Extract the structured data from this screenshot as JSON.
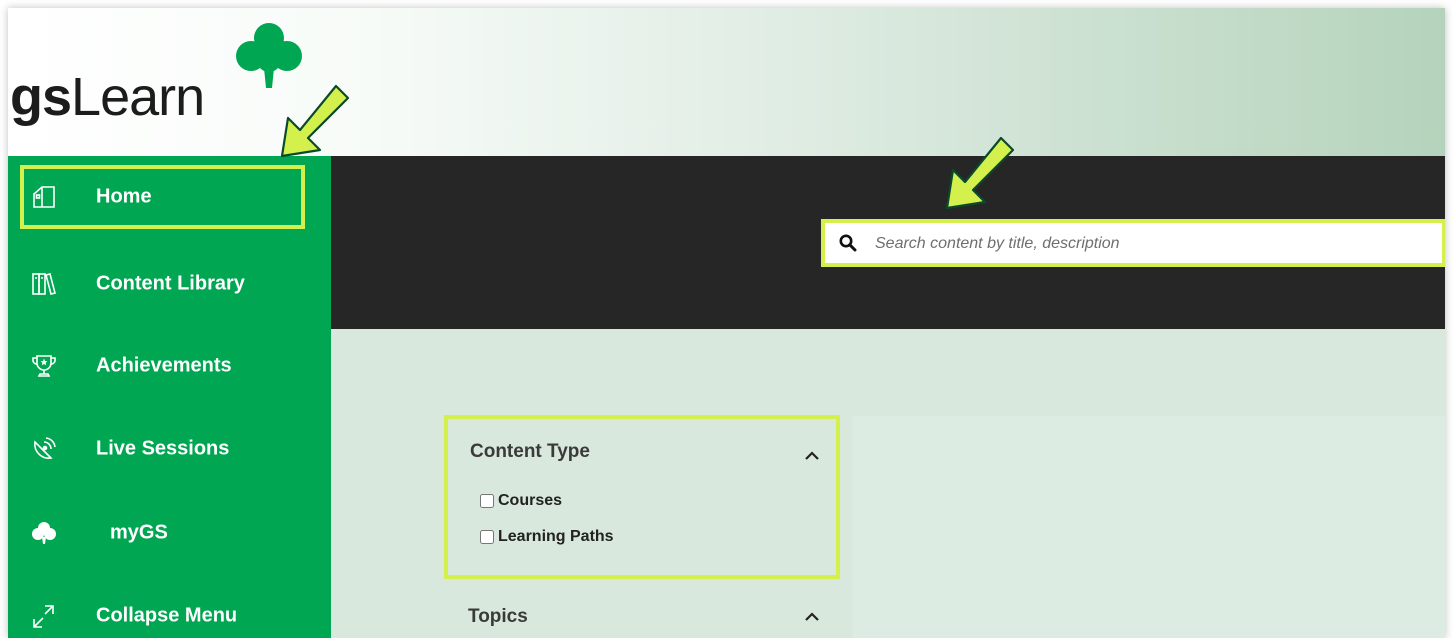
{
  "logo": {
    "prefix": "gs",
    "suffix": "Learn"
  },
  "sidebar": {
    "items": [
      {
        "label": "Home",
        "icon": "home-icon"
      },
      {
        "label": "Content Library",
        "icon": "library-icon"
      },
      {
        "label": "Achievements",
        "icon": "trophy-icon"
      },
      {
        "label": "Live Sessions",
        "icon": "satellite-icon"
      },
      {
        "label": "myGS",
        "icon": "clover-icon"
      },
      {
        "label": "Collapse Menu",
        "icon": "collapse-icon"
      }
    ]
  },
  "search": {
    "placeholder": "Search content by title, description"
  },
  "filters": {
    "content_type": {
      "title": "Content Type",
      "options": [
        {
          "label": "Courses",
          "checked": false
        },
        {
          "label": "Learning Paths",
          "checked": false
        }
      ]
    },
    "topics": {
      "title": "Topics"
    }
  },
  "colors": {
    "sidebar": "#00a651",
    "highlight": "#d4f04c",
    "darkbar": "#262626",
    "background": "#d9e8dc"
  }
}
